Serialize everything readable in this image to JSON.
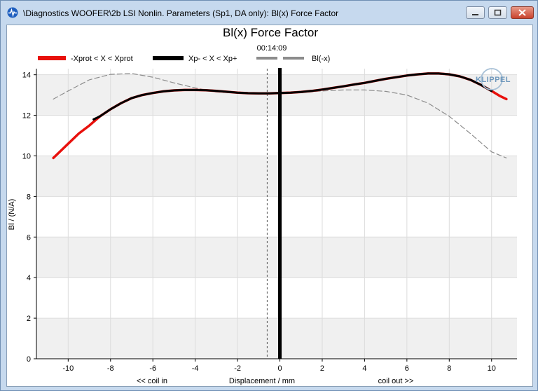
{
  "window": {
    "title": "\\Diagnostics WOOFER\\2b LSI Nonlin. Parameters (Sp1, DA only): Bl(x) Force Factor",
    "app_icon": "pulse-icon",
    "buttons": [
      "minimize-icon",
      "maximize-icon",
      "close-icon"
    ]
  },
  "logo_text": "KLIPPEL",
  "chart_data": {
    "type": "line",
    "title": "Bl(x) Force Factor",
    "subtitle": "00:14:09",
    "xlabel": "Displacement / mm",
    "xlabel_left": "<< coil in",
    "xlabel_right": "coil out >>",
    "ylabel": "Bl / (N/A)",
    "xlim": [
      -11.5,
      11.2
    ],
    "ylim": [
      0,
      14.3
    ],
    "xticks": [
      -10,
      -8,
      -6,
      -4,
      -2,
      0,
      2,
      4,
      6,
      8,
      10
    ],
    "yticks": [
      0,
      2,
      4,
      6,
      8,
      10,
      12,
      14
    ],
    "grid": true,
    "band_shading": true,
    "legend_placement": "top",
    "rest_position_x": 0,
    "dashed_marker_x": -0.6,
    "series": [
      {
        "name": "-Xprot < X < Xprot",
        "color": "#e8100c",
        "style": "solid",
        "x": [
          -10.7,
          -10.4,
          -10.0,
          -9.5,
          -9.0,
          -8.5,
          -8.0,
          -7.5,
          -7.0,
          -6.5,
          -6.0,
          -5.5,
          -5.0,
          -4.5,
          -4.0,
          -3.5,
          -3.0,
          -2.5,
          -2.0,
          -1.5,
          -1.0,
          -0.5,
          0.0,
          0.5,
          1.0,
          1.5,
          2.0,
          2.5,
          3.0,
          3.5,
          4.0,
          4.5,
          5.0,
          5.5,
          6.0,
          6.5,
          7.0,
          7.5,
          8.0,
          8.5,
          9.0,
          9.5,
          10.0,
          10.4,
          10.7
        ],
        "y": [
          9.9,
          10.2,
          10.6,
          11.1,
          11.5,
          11.95,
          12.3,
          12.6,
          12.85,
          13.0,
          13.1,
          13.18,
          13.23,
          13.25,
          13.25,
          13.24,
          13.2,
          13.16,
          13.12,
          13.09,
          13.08,
          13.08,
          13.1,
          13.12,
          13.15,
          13.2,
          13.27,
          13.35,
          13.43,
          13.52,
          13.6,
          13.7,
          13.8,
          13.88,
          13.96,
          14.02,
          14.06,
          14.06,
          14.02,
          13.92,
          13.75,
          13.5,
          13.2,
          12.95,
          12.8
        ]
      },
      {
        "name": "Xp- < X < Xp+",
        "color": "#000000",
        "style": "solid",
        "x": [
          -8.8,
          -8.5,
          -8.0,
          -7.5,
          -7.0,
          -6.5,
          -6.0,
          -5.5,
          -5.0,
          -4.5,
          -4.0,
          -3.5,
          -3.0,
          -2.5,
          -2.0,
          -1.5,
          -1.0,
          -0.5,
          0.0,
          0.5,
          1.0,
          1.5,
          2.0,
          2.5,
          3.0,
          3.5,
          4.0,
          4.5,
          5.0,
          5.5,
          6.0,
          6.5,
          7.0,
          7.5,
          8.0,
          8.5,
          9.0,
          9.5,
          10.0
        ],
        "y": [
          11.8,
          11.95,
          12.3,
          12.6,
          12.85,
          13.0,
          13.1,
          13.18,
          13.23,
          13.25,
          13.25,
          13.24,
          13.2,
          13.16,
          13.12,
          13.09,
          13.08,
          13.08,
          13.1,
          13.12,
          13.15,
          13.2,
          13.27,
          13.35,
          13.43,
          13.52,
          13.6,
          13.7,
          13.8,
          13.88,
          13.96,
          14.02,
          14.06,
          14.06,
          14.02,
          13.92,
          13.75,
          13.5,
          13.2
        ]
      },
      {
        "name": "Bl(-x)",
        "color": "#8c8c8c",
        "style": "dashed",
        "x": [
          -10.7,
          -10.0,
          -9.0,
          -8.0,
          -7.0,
          -6.0,
          -5.0,
          -4.0,
          -3.0,
          -2.0,
          -1.0,
          0.0,
          1.0,
          2.0,
          3.0,
          4.0,
          5.0,
          6.0,
          7.0,
          8.0,
          9.0,
          10.0,
          10.7
        ],
        "y": [
          12.8,
          13.2,
          13.75,
          14.02,
          14.06,
          13.88,
          13.6,
          13.35,
          13.15,
          13.1,
          13.08,
          13.1,
          13.12,
          13.2,
          13.25,
          13.25,
          13.18,
          13.0,
          12.6,
          11.95,
          11.1,
          10.2,
          9.9
        ]
      }
    ]
  }
}
